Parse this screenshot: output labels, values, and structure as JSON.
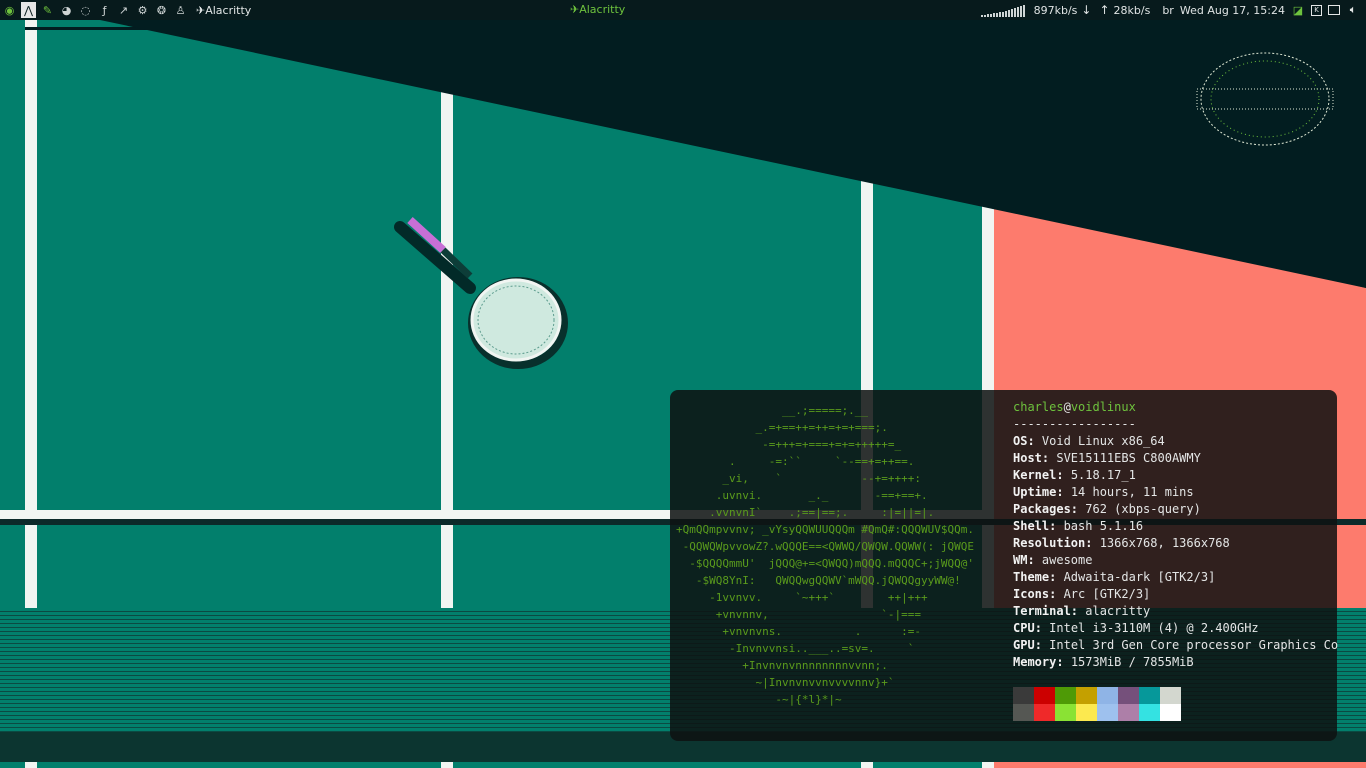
{
  "topbar": {
    "launchers": [
      {
        "name": "void-icon",
        "glyph": "◉",
        "active": false,
        "color": "green"
      },
      {
        "name": "arch-icon",
        "glyph": "⋀",
        "active": true,
        "color": ""
      },
      {
        "name": "editor-icon",
        "glyph": "✎",
        "active": false,
        "color": "green"
      },
      {
        "name": "gimp-icon",
        "glyph": "◕",
        "active": false,
        "color": ""
      },
      {
        "name": "debian-icon",
        "glyph": "◌",
        "active": false,
        "color": ""
      },
      {
        "name": "fedora-icon",
        "glyph": "ƒ",
        "active": false,
        "color": ""
      },
      {
        "name": "link-icon",
        "glyph": "↗",
        "active": false,
        "color": ""
      },
      {
        "name": "gear-icon",
        "glyph": "⚙",
        "active": false,
        "color": ""
      },
      {
        "name": "raspberry-icon",
        "glyph": "❂",
        "active": false,
        "color": ""
      },
      {
        "name": "penguin-icon",
        "glyph": "♙",
        "active": false,
        "color": ""
      }
    ],
    "task_title": "✈Alacritty",
    "center_title": "✈Alacritty",
    "net_down": "897kb/s",
    "net_up": "28kb/s",
    "keyboard_layout": "br",
    "clock": "Wed Aug 17, 15:24",
    "tray_icons": [
      "network-icon",
      "keyboard-icon",
      "display-icon",
      "volume-icon"
    ]
  },
  "terminal": {
    "ascii_logo": "                __.;=====;.__\n            _.=+==++=++=+=+===;.\n             -=+++=+===+=+=+++++=_\n        .     -=:``     `--==+=++==.\n       _vi,    `            --+=++++:\n      .uvnvi.       _._       -==+==+.\n     .vvnvnI`    .;==|==;.     :|=||=|.\n+QmQQmpvvnv; _vYsyQQWUUQQQm #QmQ#:QQQWUV$QQm.\n -QQWQWpvvowZ?.wQQQE==<QWWQ/QWQW.QQWW(: jQWQE\n  -$QQQQmmU'  jQQQ@+=<QWQQ)mQQQ.mQQQC+;jWQQ@'\n   -$WQ8YnI:   QWQQwgQQWV`mWQQ.jQWQQgyyWW@!\n     -1vvnvv.     `~+++`        ++|+++\n      +vnvnnv,                 `-|===\n       +vnvnvns.           .      :=-\n        -Invnvvnsi..___..=sv=.     `\n          +Invnvnvnnnnnnnnvvnn;.\n            ~|Invnvnvvnvvvvnnv}+`\n               -~|{*l}*|~",
    "user": "charles",
    "at": "@",
    "host": "voidlinux",
    "separator": "-----------------",
    "info": [
      {
        "key": "OS",
        "value": "Void Linux x86_64"
      },
      {
        "key": "Host",
        "value": "SVE15111EBS C800AWMY"
      },
      {
        "key": "Kernel",
        "value": "5.18.17_1"
      },
      {
        "key": "Uptime",
        "value": "14 hours, 11 mins"
      },
      {
        "key": "Packages",
        "value": "762 (xbps-query)"
      },
      {
        "key": "Shell",
        "value": "bash 5.1.16"
      },
      {
        "key": "Resolution",
        "value": "1366x768, 1366x768"
      },
      {
        "key": "WM",
        "value": "awesome"
      },
      {
        "key": "Theme",
        "value": "Adwaita-dark [GTK2/3]"
      },
      {
        "key": "Icons",
        "value": "Arc [GTK2/3]"
      },
      {
        "key": "Terminal",
        "value": "alacritty"
      },
      {
        "key": "CPU",
        "value": "Intel i3-3110M (4) @ 2.400GHz"
      },
      {
        "key": "GPU",
        "value": "Intel 3rd Gen Core processor Graphics Co"
      },
      {
        "key": "Memory",
        "value": "1573MiB / 7855MiB"
      }
    ],
    "palette": [
      [
        "#3a3a3a",
        "#cc0000",
        "#4e9a06",
        "#c4a000",
        "#8fb4e6",
        "#75507b",
        "#06989a",
        "#d3d7cf"
      ],
      [
        "#555753",
        "#ef2929",
        "#8ae234",
        "#fce94f",
        "#9ec1ee",
        "#ad7fa8",
        "#34e2e2",
        "#ffffff"
      ]
    ]
  },
  "wallpaper": {
    "court_color": "#027f6c",
    "shadow_color": "#021d20",
    "line_color": "#f1f5f2",
    "salmon_color": "#fd7b6d"
  }
}
